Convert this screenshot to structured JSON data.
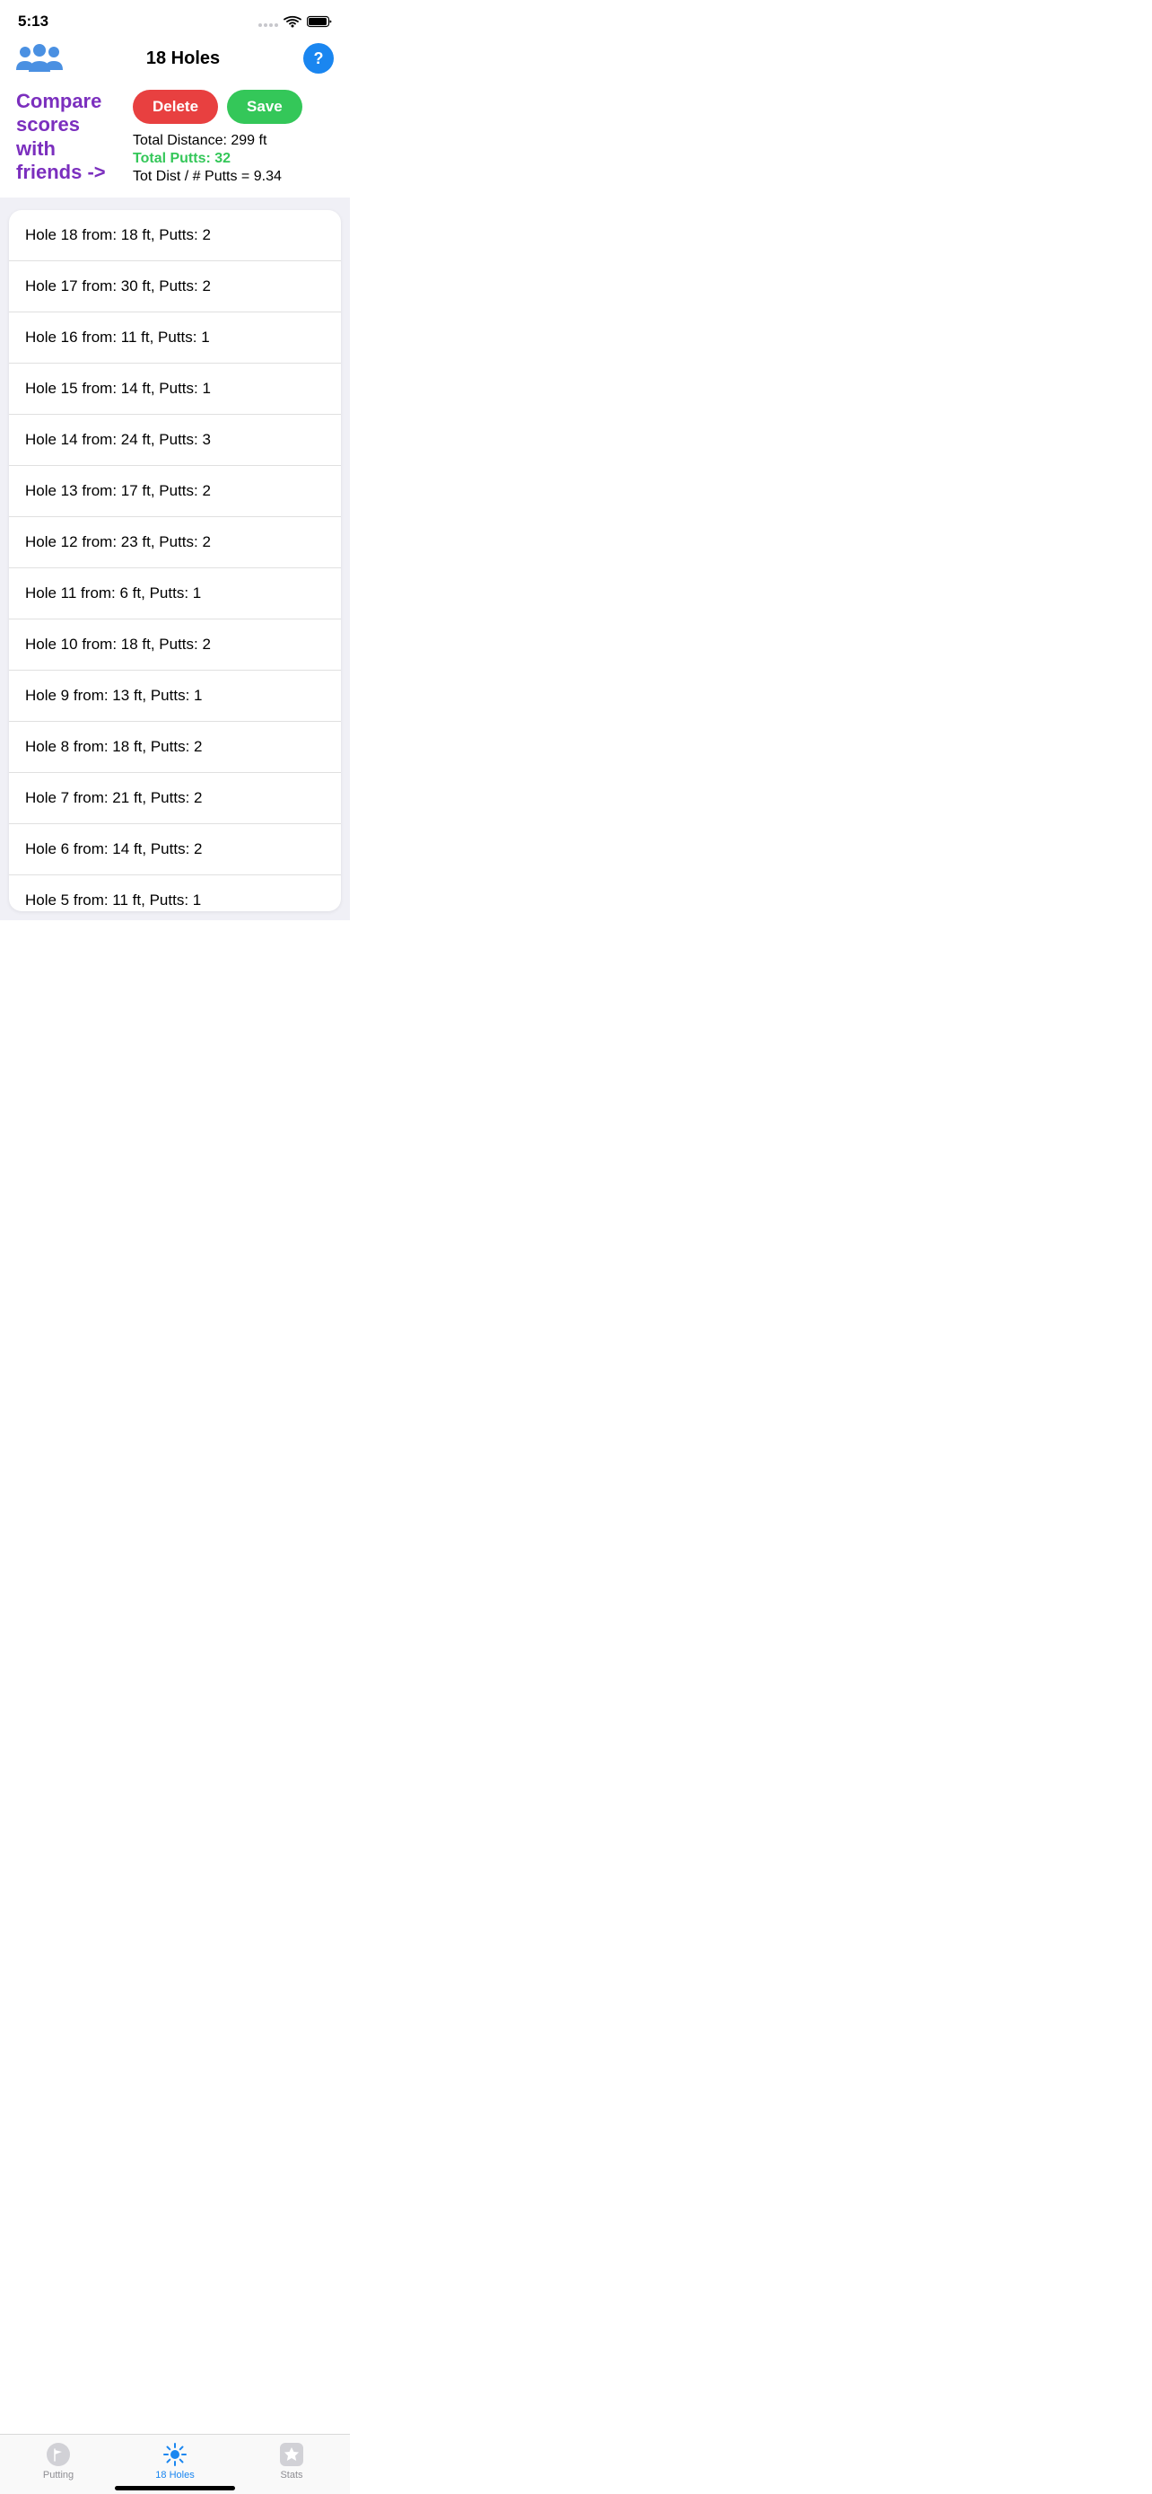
{
  "statusBar": {
    "time": "5:13"
  },
  "header": {
    "title": "18 Holes",
    "helpIcon": "?"
  },
  "compareLabel": "Compare scores with friends ->",
  "compareArrow": "->",
  "buttons": {
    "delete": "Delete",
    "save": "Save"
  },
  "stats": {
    "totalDistance": "Total Distance: 299 ft",
    "totalPutts": "Total Putts: 32",
    "ratio": "Tot Dist / # Putts = 9.34"
  },
  "holes": [
    {
      "label": "Hole 18 from: 18 ft, Putts: 2"
    },
    {
      "label": "Hole 17 from: 30 ft, Putts: 2"
    },
    {
      "label": "Hole 16 from: 11 ft, Putts: 1"
    },
    {
      "label": "Hole 15 from: 14 ft, Putts: 1"
    },
    {
      "label": "Hole 14 from: 24 ft, Putts: 3"
    },
    {
      "label": "Hole 13 from: 17 ft, Putts: 2"
    },
    {
      "label": "Hole 12 from: 23 ft, Putts: 2"
    },
    {
      "label": "Hole 11 from: 6 ft, Putts: 1"
    },
    {
      "label": "Hole 10 from: 18 ft, Putts: 2"
    },
    {
      "label": "Hole 9 from: 13 ft, Putts: 1"
    },
    {
      "label": "Hole 8 from: 18 ft, Putts: 2"
    },
    {
      "label": "Hole 7 from: 21 ft, Putts: 2"
    },
    {
      "label": "Hole 6 from: 14 ft, Putts: 2"
    },
    {
      "label": "Hole 5 from: 11 ft, Putts: 1"
    }
  ],
  "tabs": [
    {
      "label": "Putting",
      "active": false,
      "icon": "flag"
    },
    {
      "label": "18 Holes",
      "active": true,
      "icon": "sun"
    },
    {
      "label": "Stats",
      "active": false,
      "icon": "star"
    }
  ]
}
